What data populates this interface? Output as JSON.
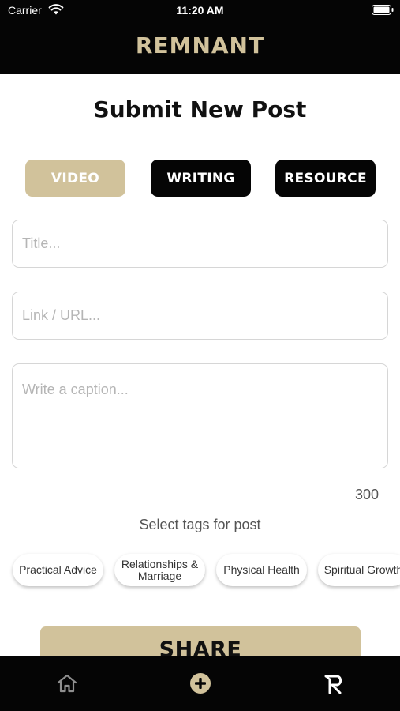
{
  "status_bar": {
    "carrier": "Carrier",
    "time": "11:20 AM",
    "wifi_icon": "wifi-icon",
    "battery_icon": "battery-icon"
  },
  "header": {
    "brand": "REMNANT"
  },
  "page": {
    "title": "Submit New Post"
  },
  "post_types": [
    {
      "label": "VIDEO",
      "selected": true
    },
    {
      "label": "WRITING",
      "selected": false
    },
    {
      "label": "RESOURCE",
      "selected": false
    }
  ],
  "form": {
    "title_placeholder": "Title...",
    "title_value": "",
    "url_placeholder": "Link / URL...",
    "url_value": "",
    "caption_placeholder": "Write a caption...",
    "caption_value": "",
    "char_count": "300"
  },
  "tags": {
    "prompt": "Select tags for post",
    "items": [
      {
        "label": "Practical Advice"
      },
      {
        "label": "Relationships & Marriage"
      },
      {
        "label": "Physical Health"
      },
      {
        "label": "Spiritual Growth"
      }
    ]
  },
  "share_label": "SHARE",
  "bottom_nav": {
    "items": [
      {
        "icon": "home-icon"
      },
      {
        "icon": "add-circle-icon"
      },
      {
        "icon": "remnant-logo-icon"
      }
    ]
  },
  "colors": {
    "accent": "#d1c29b",
    "bar": "#050505",
    "background": "#ffffff"
  }
}
